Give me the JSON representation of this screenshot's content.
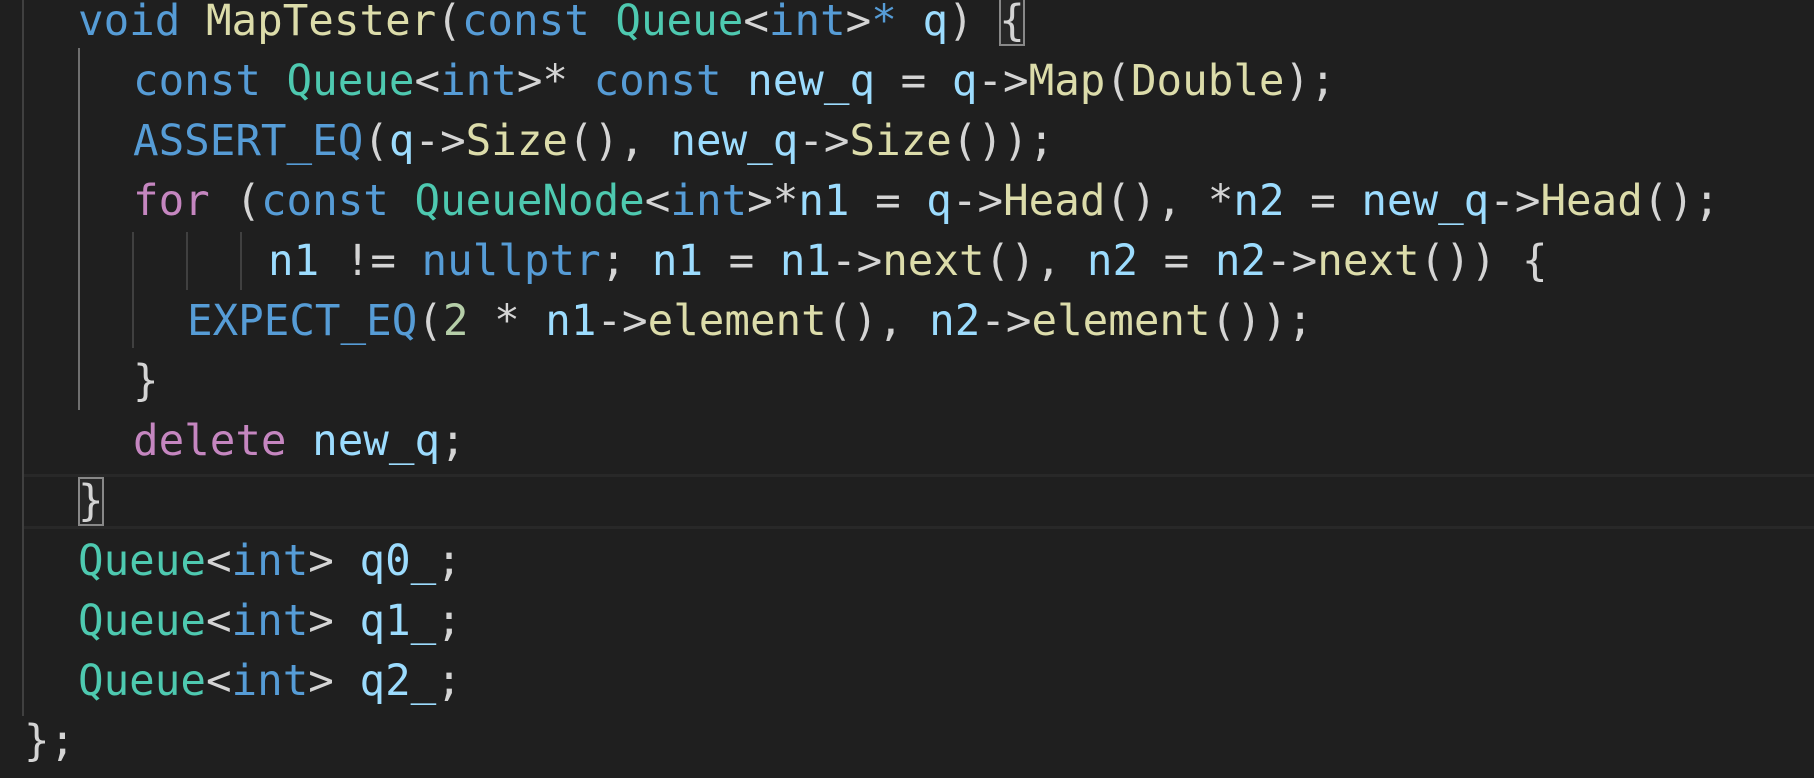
{
  "editor": {
    "language": "cpp",
    "theme_colors": {
      "background": "#1f1f1f",
      "keyword": "#569cd6",
      "control": "#c586c0",
      "type": "#4ec9b0",
      "function": "#dcdcaa",
      "variable": "#9cdcfe",
      "number": "#b5cea8",
      "text": "#d4d4d4"
    },
    "lines": [
      [
        {
          "t": "void",
          "c": "kw"
        },
        {
          "t": " "
        },
        {
          "t": "MapTester",
          "c": "fn"
        },
        {
          "t": "("
        },
        {
          "t": "const",
          "c": "kw"
        },
        {
          "t": " "
        },
        {
          "t": "Queue",
          "c": "type"
        },
        {
          "t": "<"
        },
        {
          "t": "int",
          "c": "kw"
        },
        {
          "t": ">"
        },
        {
          "t": "*",
          "c": "kw"
        },
        {
          "t": " "
        },
        {
          "t": "q",
          "c": "var"
        },
        {
          "t": ") "
        },
        {
          "t": "{",
          "c": "brace",
          "box": true
        }
      ],
      [
        {
          "t": "const",
          "c": "kw"
        },
        {
          "t": " "
        },
        {
          "t": "Queue",
          "c": "type"
        },
        {
          "t": "<"
        },
        {
          "t": "int",
          "c": "kw"
        },
        {
          "t": ">* "
        },
        {
          "t": "const",
          "c": "kw"
        },
        {
          "t": " "
        },
        {
          "t": "new_q",
          "c": "var"
        },
        {
          "t": " = "
        },
        {
          "t": "q",
          "c": "var"
        },
        {
          "t": "->"
        },
        {
          "t": "Map",
          "c": "fn"
        },
        {
          "t": "("
        },
        {
          "t": "Double",
          "c": "fn"
        },
        {
          "t": ");"
        }
      ],
      [
        {
          "t": "ASSERT_EQ",
          "c": "mac"
        },
        {
          "t": "("
        },
        {
          "t": "q",
          "c": "var"
        },
        {
          "t": "->"
        },
        {
          "t": "Size",
          "c": "fn"
        },
        {
          "t": "(), "
        },
        {
          "t": "new_q",
          "c": "var"
        },
        {
          "t": "->"
        },
        {
          "t": "Size",
          "c": "fn"
        },
        {
          "t": "());"
        }
      ],
      [
        {
          "t": "for",
          "c": "ctl"
        },
        {
          "t": " ("
        },
        {
          "t": "const",
          "c": "kw"
        },
        {
          "t": " "
        },
        {
          "t": "QueueNode",
          "c": "type"
        },
        {
          "t": "<"
        },
        {
          "t": "int",
          "c": "kw"
        },
        {
          "t": ">*"
        },
        {
          "t": "n1",
          "c": "var"
        },
        {
          "t": " = "
        },
        {
          "t": "q",
          "c": "var"
        },
        {
          "t": "->"
        },
        {
          "t": "Head",
          "c": "fn"
        },
        {
          "t": "(), *"
        },
        {
          "t": "n2",
          "c": "var"
        },
        {
          "t": " = "
        },
        {
          "t": "new_q",
          "c": "var"
        },
        {
          "t": "->"
        },
        {
          "t": "Head",
          "c": "fn"
        },
        {
          "t": "();"
        }
      ],
      [
        {
          "t": "n1",
          "c": "var"
        },
        {
          "t": " != "
        },
        {
          "t": "nullptr",
          "c": "kw"
        },
        {
          "t": "; "
        },
        {
          "t": "n1",
          "c": "var"
        },
        {
          "t": " = "
        },
        {
          "t": "n1",
          "c": "var"
        },
        {
          "t": "->"
        },
        {
          "t": "next",
          "c": "fn"
        },
        {
          "t": "(), "
        },
        {
          "t": "n2",
          "c": "var"
        },
        {
          "t": " = "
        },
        {
          "t": "n2",
          "c": "var"
        },
        {
          "t": "->"
        },
        {
          "t": "next",
          "c": "fn"
        },
        {
          "t": "()) {"
        }
      ],
      [
        {
          "t": "EXPECT_EQ",
          "c": "mac"
        },
        {
          "t": "("
        },
        {
          "t": "2",
          "c": "num"
        },
        {
          "t": " * "
        },
        {
          "t": "n1",
          "c": "var"
        },
        {
          "t": "->"
        },
        {
          "t": "element",
          "c": "fn"
        },
        {
          "t": "(), "
        },
        {
          "t": "n2",
          "c": "var"
        },
        {
          "t": "->"
        },
        {
          "t": "element",
          "c": "fn"
        },
        {
          "t": "());"
        }
      ],
      [
        {
          "t": "}"
        }
      ],
      [
        {
          "t": "delete",
          "c": "ctl"
        },
        {
          "t": " "
        },
        {
          "t": "new_q",
          "c": "var"
        },
        {
          "t": ";"
        }
      ],
      [
        {
          "t": "}",
          "c": "brace",
          "box": true
        }
      ],
      [
        {
          "t": "Queue",
          "c": "type"
        },
        {
          "t": "<"
        },
        {
          "t": "int",
          "c": "kw"
        },
        {
          "t": "> "
        },
        {
          "t": "q0_",
          "c": "var"
        },
        {
          "t": ";"
        }
      ],
      [
        {
          "t": "Queue",
          "c": "type"
        },
        {
          "t": "<"
        },
        {
          "t": "int",
          "c": "kw"
        },
        {
          "t": "> "
        },
        {
          "t": "q1_",
          "c": "var"
        },
        {
          "t": ";"
        }
      ],
      [
        {
          "t": "Queue",
          "c": "type"
        },
        {
          "t": "<"
        },
        {
          "t": "int",
          "c": "kw"
        },
        {
          "t": "> "
        },
        {
          "t": "q2_",
          "c": "var"
        },
        {
          "t": ";"
        }
      ],
      [
        {
          "t": "};"
        }
      ]
    ]
  }
}
